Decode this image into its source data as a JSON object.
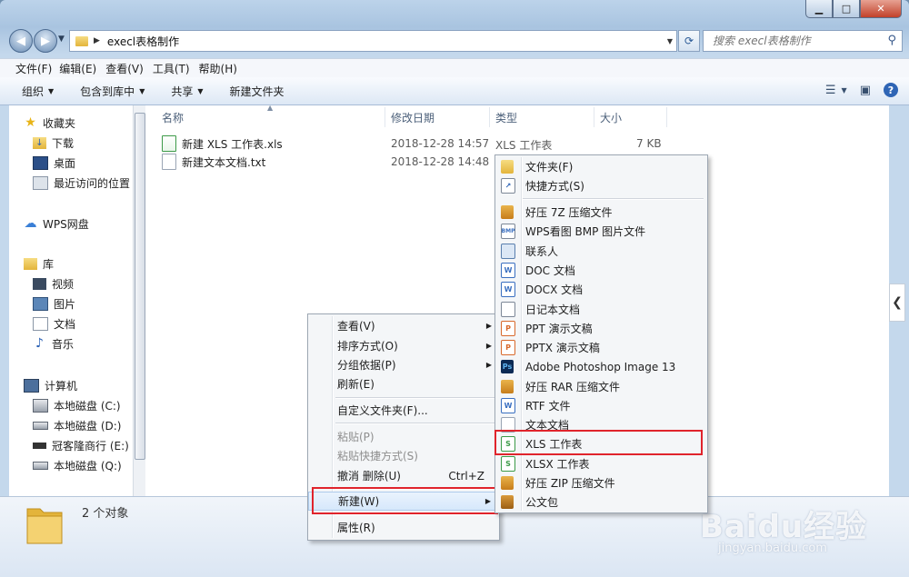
{
  "window": {
    "address_path": "execl表格制作",
    "search_placeholder": "搜索 execl表格制作"
  },
  "menubar": [
    "文件(F)",
    "编辑(E)",
    "查看(V)",
    "工具(T)",
    "帮助(H)"
  ],
  "toolbar": {
    "organize": "组织",
    "include_in_library": "包含到库中",
    "share": "共享",
    "new_folder": "新建文件夹"
  },
  "navpane": {
    "favorites": "收藏夹",
    "downloads": "下载",
    "desktop": "桌面",
    "recent": "最近访问的位置",
    "wps": "WPS网盘",
    "libraries": "库",
    "videos": "视频",
    "pictures": "图片",
    "documents": "文档",
    "music": "音乐",
    "computer": "计算机",
    "drive_c": "本地磁盘 (C:)",
    "drive_d": "本地磁盘 (D:)",
    "drive_e": "冠客隆商行 (E:)",
    "drive_q": "本地磁盘 (Q:)"
  },
  "columns": {
    "name": "名称",
    "date": "修改日期",
    "type": "类型",
    "size": "大小"
  },
  "files": [
    {
      "name": "新建 XLS 工作表.xls",
      "date": "2018-12-28 14:57",
      "type": "XLS 工作表",
      "size": "7 KB"
    },
    {
      "name": "新建文本文档.txt",
      "date": "2018-12-28 14:48",
      "type": "",
      "size": ""
    }
  ],
  "context_menu": {
    "view": "查看(V)",
    "sort_by": "排序方式(O)",
    "group_by": "分组依据(P)",
    "refresh": "刷新(E)",
    "customize": "自定义文件夹(F)...",
    "paste": "粘贴(P)",
    "paste_shortcut": "粘贴快捷方式(S)",
    "undo_delete": "撤消 删除(U)",
    "undo_shortcut": "Ctrl+Z",
    "new": "新建(W)",
    "properties": "属性(R)"
  },
  "new_submenu": {
    "folder": "文件夹(F)",
    "shortcut": "快捷方式(S)",
    "haozip_7z": "好压 7Z 压缩文件",
    "wps_bmp": "WPS看图 BMP 图片文件",
    "contact": "联系人",
    "doc": "DOC 文档",
    "docx": "DOCX 文档",
    "journal": "日记本文档",
    "ppt": "PPT 演示文稿",
    "pptx": "PPTX 演示文稿",
    "photoshop": "Adobe Photoshop Image 13",
    "haozip_rar": "好压 RAR 压缩文件",
    "rtf": "RTF 文件",
    "text": "文本文档",
    "xls": "XLS 工作表",
    "xlsx": "XLSX 工作表",
    "haozip_zip": "好压 ZIP 压缩文件",
    "briefcase": "公文包"
  },
  "status": {
    "count": "2 个对象"
  },
  "watermark": {
    "main": "Baidu经验",
    "sub": "jingyan.baidu.com"
  },
  "colors": {
    "highlight_box": "#e0242c",
    "accent": "#2f65b5"
  }
}
